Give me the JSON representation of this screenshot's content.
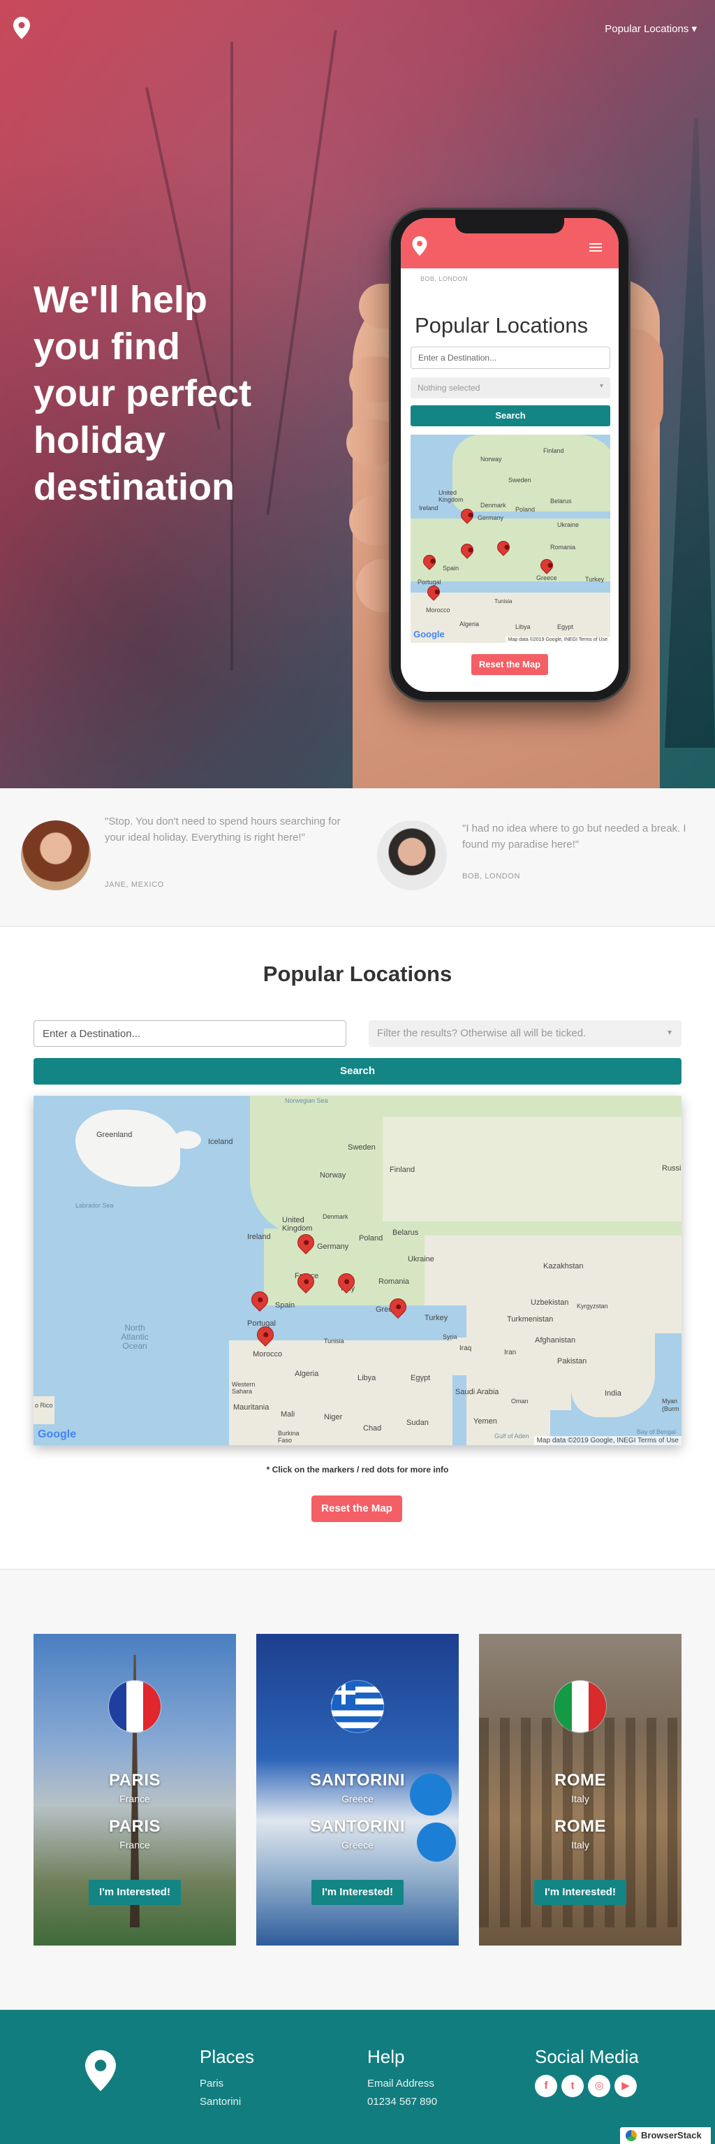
{
  "nav": {
    "logo_icon": "map-pin-icon",
    "dropdown_label": "Popular Locations ▾"
  },
  "hero": {
    "title": "We'll help you find your perfect holiday destination"
  },
  "phone": {
    "attribution": "BOB, LONDON",
    "title": "Popular Locations",
    "input_placeholder": "Enter a Destination...",
    "select_placeholder": "Nothing selected",
    "search_label": "Search",
    "reset_label": "Reset the Map",
    "map_labels": [
      "Finland",
      "Norway",
      "Sweden",
      "United Kingdom",
      "Denmark",
      "Ireland",
      "Germany",
      "Poland",
      "Belarus",
      "Ukraine",
      "Spain",
      "Portugal",
      "Romania",
      "Turkey",
      "Morocco",
      "Algeria",
      "Tunisia",
      "Libya",
      "Egypt",
      "Greece"
    ],
    "map_copy": "Map data ©2019 Google, INEGI   Terms of Use",
    "google_logo": "Google"
  },
  "testimonials": [
    {
      "quote": "\"Stop. You don't need to spend hours searching for your ideal holiday. Everything is right here!\"",
      "author": "JANE, MEXICO"
    },
    {
      "quote": "\"I had no idea where to go but needed a break. I found my paradise here!\"",
      "author": "BOB, LONDON"
    }
  ],
  "popular": {
    "title": "Popular Locations",
    "input_placeholder": "Enter a Destination...",
    "select_placeholder": "Filter the results? Otherwise all will be ticked.",
    "search_label": "Search",
    "map_labels": [
      "Norwegian Sea",
      "Greenland",
      "Iceland",
      "Sweden",
      "Finland",
      "Norway",
      "Russia",
      "Labrador Sea",
      "United Kingdom",
      "Denmark",
      "Ireland",
      "Germany",
      "Poland",
      "Belarus",
      "Ukraine",
      "France",
      "Italy",
      "Romania",
      "Kazakhstan",
      "Spain",
      "Portugal",
      "Greece",
      "Turkey",
      "Uzbekistan",
      "Kyrgyzstan",
      "Turkmenistan",
      "North Atlantic Ocean",
      "Morocco",
      "Tunisia",
      "Syria",
      "Iraq",
      "Iran",
      "Afghanistan",
      "Pakistan",
      "Algeria",
      "Libya",
      "Egypt",
      "Saudi Arabia",
      "India",
      "Western Sahara",
      "Mauritania",
      "Mali",
      "Niger",
      "Chad",
      "Sudan",
      "Oman",
      "Yemen",
      "Burkina Faso",
      "Bay of Bengal",
      "Gulf of Aden",
      "o Rico",
      "Myan (Burm"
    ],
    "map_copy": "Map data ©2019 Google, INEGI   Terms of Use",
    "google_logo": "Google",
    "note": "* Click on the markers / red dots for more info",
    "reset_label": "Reset the Map"
  },
  "cards": [
    {
      "city": "PARIS",
      "country": "France",
      "button": "I'm Interested!",
      "flag_colors": [
        "#1f3fa0",
        "#ffffff",
        "#e1262d"
      ]
    },
    {
      "city": "SANTORINI",
      "country": "Greece",
      "button": "I'm Interested!",
      "flag_colors": [
        "#1a62c4",
        "#ffffff"
      ]
    },
    {
      "city": "ROME",
      "country": "Italy",
      "button": "I'm Interested!",
      "flag_colors": [
        "#149a45",
        "#ffffff",
        "#d92b2b"
      ]
    }
  ],
  "footer": {
    "places_title": "Places",
    "places": [
      "Paris",
      "Santorini"
    ],
    "help_title": "Help",
    "help": [
      "Email Address",
      "01234 567 890"
    ],
    "social_title": "Social Media",
    "social_icons": [
      "facebook-icon",
      "twitter-icon",
      "instagram-icon",
      "youtube-icon"
    ],
    "social_glyphs": [
      "f",
      "t",
      "◎",
      "▶"
    ]
  },
  "badge": "BrowserStack",
  "colors": {
    "accent_teal": "#138585",
    "accent_coral": "#f45f65",
    "footer_teal": "#117d7f"
  }
}
